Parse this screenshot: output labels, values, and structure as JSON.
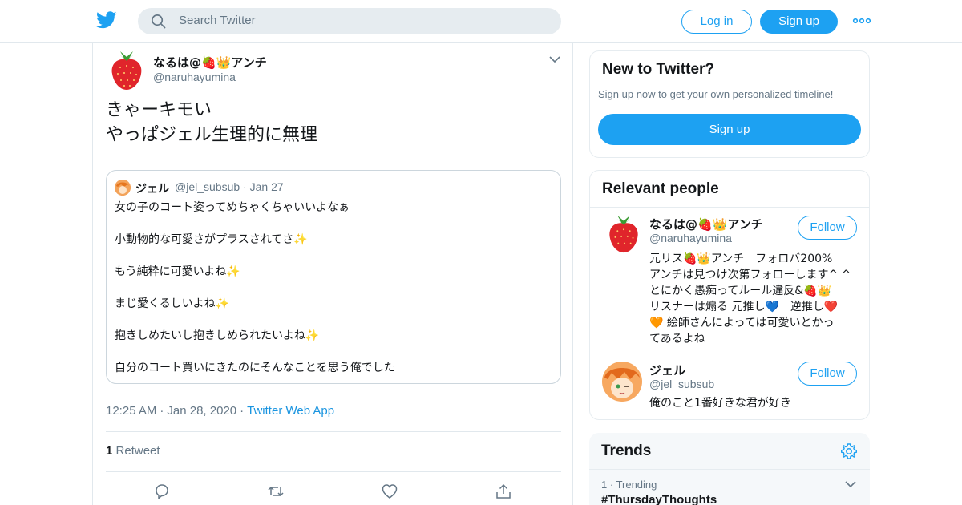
{
  "header": {
    "search_placeholder": "Search Twitter",
    "login_label": "Log in",
    "signup_label": "Sign up"
  },
  "tweet": {
    "author_name": "なるは@🍓👑アンチ",
    "author_handle": "@naruhayumina",
    "text_lines": [
      "きゃーキモい",
      "やっぱジェル生理的に無理"
    ],
    "quote": {
      "name": "ジェル",
      "handle": "@jel_subsub",
      "date": "Jan 27",
      "lines": [
        "女の子のコート姿ってめちゃくちゃいいよなぁ",
        "小動物的な可愛さがプラスされてさ✨",
        "もう純粋に可愛いよね✨",
        "まじ愛くるしいよね✨",
        "抱きしめたいし抱きしめられたいよね✨",
        "自分のコート買いにきたのにそんなことを思う俺でした"
      ]
    },
    "time": "12:25 AM",
    "date": "Jan 28, 2020",
    "source": "Twitter Web App",
    "retweet_count": "1",
    "retweet_label": "Retweet"
  },
  "sidebar": {
    "new": {
      "title": "New to Twitter?",
      "subtitle": "Sign up now to get your own personalized timeline!",
      "signup_label": "Sign up"
    },
    "relevant": {
      "title": "Relevant people",
      "people": [
        {
          "name": "なるは@🍓👑アンチ",
          "handle": "@naruhayumina",
          "follow_label": "Follow",
          "bio_lines": [
            "元リス🍓👑アンチ　フォロバ200%",
            "アンチは見つけ次第フォローします^ ^",
            "とにかく愚痴ってルール違反&🍓👑",
            "リスナーは煽る 元推し💙　逆推し❤️",
            "🧡 絵師さんによっては可愛いとかっ",
            "てあるよね"
          ]
        },
        {
          "name": "ジェル",
          "handle": "@jel_subsub",
          "follow_label": "Follow",
          "bio_lines": [
            "俺のこと1番好きな君が好き"
          ]
        }
      ]
    },
    "trends": {
      "title": "Trends",
      "items": [
        {
          "rank": "1",
          "label": "Trending",
          "tag": "#ThursdayThoughts"
        }
      ]
    }
  }
}
